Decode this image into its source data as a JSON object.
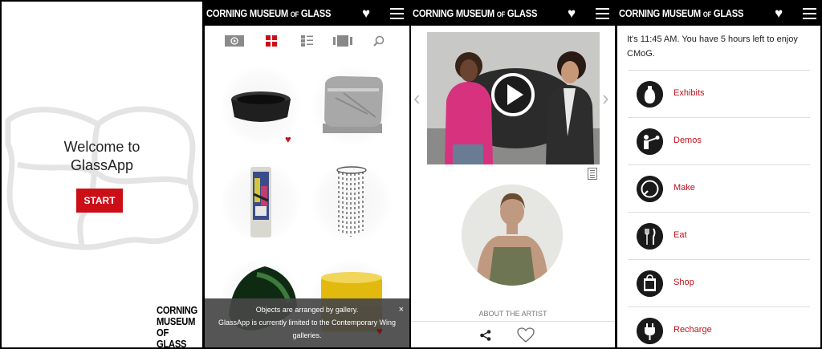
{
  "welcome": {
    "line1": "Welcome to",
    "line2": "GlassApp",
    "start_label": "START",
    "logo": [
      "CORNING",
      "MUSEUM",
      "OF GLASS"
    ]
  },
  "brand": {
    "corning": "CORNING MUSEUM",
    "of": "OF",
    "glass": "GLASS"
  },
  "gallery": {
    "view_icons": [
      "video-view-icon",
      "grid-view-icon",
      "list-view-icon",
      "filmstrip-view-icon",
      "search-icon"
    ],
    "active_color": "#cc0e17",
    "toast_line1": "Objects are arranged by gallery.",
    "toast_line2": "GlassApp is currently limited to the Contemporary Wing",
    "toast_line3": "galleries.",
    "toast_close": "×"
  },
  "artist": {
    "about_label": "ABOUT THE ARTIST"
  },
  "visit": {
    "time_text": "It's 11:45 AM. You have 5 hours left to enjoy CMoG.",
    "items": [
      {
        "label": "Exhibits",
        "icon": "vase-icon"
      },
      {
        "label": "Demos",
        "icon": "glassblower-icon"
      },
      {
        "label": "Make",
        "icon": "plate-icon"
      },
      {
        "label": "Eat",
        "icon": "fork-knife-icon"
      },
      {
        "label": "Shop",
        "icon": "shop-bag-icon"
      },
      {
        "label": "Recharge",
        "icon": "plug-icon"
      }
    ],
    "accent": "#c0111b"
  }
}
